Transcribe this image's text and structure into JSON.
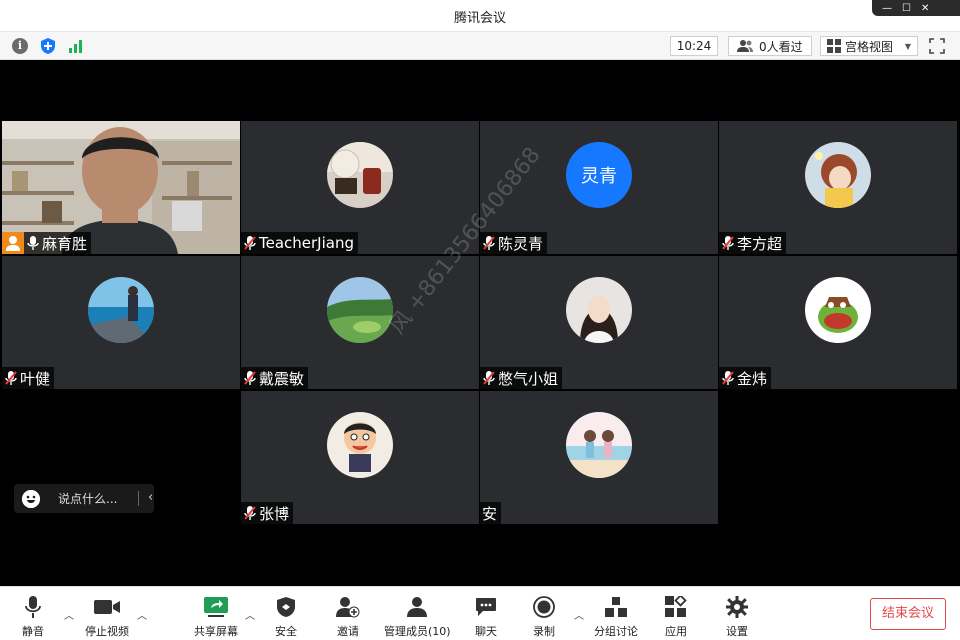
{
  "window": {
    "title": "腾讯会议"
  },
  "topbar": {
    "time": "10:24",
    "viewers_label": "0人看过",
    "view_mode_label": "宫格视图"
  },
  "participants": [
    {
      "name": "麻育胜",
      "mic": "on",
      "avatar": "video"
    },
    {
      "name": "TeacherJiang",
      "mic": "muted",
      "avatar": "photo-tea"
    },
    {
      "name": "陈灵青",
      "mic": "muted",
      "avatar": "text",
      "avatar_text": "灵青",
      "avatar_color": "#1677ff"
    },
    {
      "name": "李方超",
      "mic": "muted",
      "avatar": "anime-girl"
    },
    {
      "name": "叶健",
      "mic": "muted",
      "avatar": "photo-sea"
    },
    {
      "name": "戴震敏",
      "mic": "muted",
      "avatar": "photo-landscape"
    },
    {
      "name": "憋气小姐",
      "mic": "muted",
      "avatar": "photo-woman"
    },
    {
      "name": "金炜",
      "mic": "muted",
      "avatar": "cartoon-croc"
    },
    {
      "name": "张博",
      "mic": "muted",
      "avatar": "cartoon-boy"
    },
    {
      "name": "安",
      "mic": "none",
      "avatar": "illustration-beach"
    }
  ],
  "chat": {
    "placeholder": "说点什么..."
  },
  "watermark": "风 +8613566406868",
  "bottombar": {
    "mute": "静音",
    "stop_video": "停止视频",
    "share_screen": "共享屏幕",
    "security": "安全",
    "invite": "邀请",
    "manage_members": "管理成员(10)",
    "chat": "聊天",
    "record": "录制",
    "breakout": "分组讨论",
    "apps": "应用",
    "settings": "设置",
    "end_meeting": "结束会议"
  },
  "colors": {
    "accent": "#1677ff",
    "danger": "#e24a4a",
    "tile_bg": "#2b2c2f",
    "stage_bg": "#000000"
  }
}
